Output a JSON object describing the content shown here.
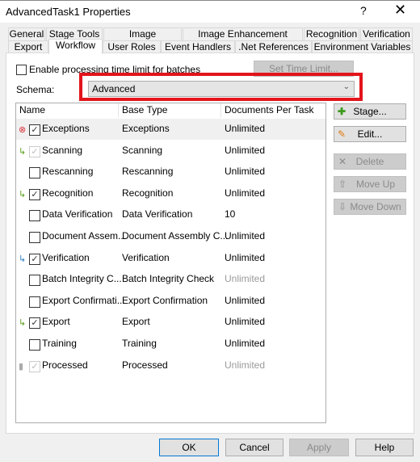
{
  "window": {
    "title": "AdvancedTask1 Properties",
    "help": "?",
    "close": "✕"
  },
  "tabs_row1": [
    "General",
    "Stage Tools",
    "Image Processing",
    "Image Enhancement Profiles",
    "Recognition",
    "Verification"
  ],
  "tabs_row2": [
    "Export",
    "Workflow",
    "User Roles",
    "Event Handlers",
    ".Net References",
    "Environment Variables"
  ],
  "active_tab": "Workflow",
  "time_limit": {
    "label": "Enable processing time limit for batches",
    "checked": false,
    "button": "Set Time Limit..."
  },
  "schema": {
    "label": "Schema:",
    "value": "Advanced",
    "highlight_color": "#e3141b"
  },
  "list": {
    "columns": [
      "Name",
      "Base Type",
      "Documents Per Task"
    ],
    "rows": [
      {
        "name": "Exceptions",
        "base": "Exceptions",
        "docs": "Unlimited",
        "checked": true,
        "icon": "error-icon",
        "selected": true
      },
      {
        "name": "Scanning",
        "base": "Scanning",
        "docs": "Unlimited",
        "checked": true,
        "disabled": true,
        "icon": "arrow-green-icon"
      },
      {
        "name": "Rescanning",
        "base": "Rescanning",
        "docs": "Unlimited",
        "checked": false
      },
      {
        "name": "Recognition",
        "base": "Recognition",
        "docs": "Unlimited",
        "checked": true,
        "icon": "arrow-green-icon"
      },
      {
        "name": "Data Verification",
        "base": "Data Verification",
        "docs": "10",
        "checked": false
      },
      {
        "name": "Document Assem...",
        "base": "Document Assembly C...",
        "docs": "Unlimited",
        "checked": false
      },
      {
        "name": "Verification",
        "base": "Verification",
        "docs": "Unlimited",
        "checked": true,
        "icon": "arrow-blue-icon"
      },
      {
        "name": "Batch Integrity C...",
        "base": "Batch Integrity Check",
        "docs": "Unlimited",
        "checked": false,
        "docs_grey": true
      },
      {
        "name": "Export Confirmati...",
        "base": "Export Confirmation",
        "docs": "Unlimited",
        "checked": false
      },
      {
        "name": "Export",
        "base": "Export",
        "docs": "Unlimited",
        "checked": true,
        "icon": "arrow-green-icon"
      },
      {
        "name": "Training",
        "base": "Training",
        "docs": "Unlimited",
        "checked": false
      },
      {
        "name": "Processed",
        "base": "Processed",
        "docs": "Unlimited",
        "checked": true,
        "disabled": true,
        "icon": "trash-icon",
        "docs_grey": true
      }
    ]
  },
  "side_buttons": {
    "stage": "Stage...",
    "edit": "Edit...",
    "delete": "Delete",
    "move_up": "Move Up",
    "move_down": "Move Down"
  },
  "footer": {
    "ok": "OK",
    "cancel": "Cancel",
    "apply": "Apply",
    "help": "Help"
  }
}
